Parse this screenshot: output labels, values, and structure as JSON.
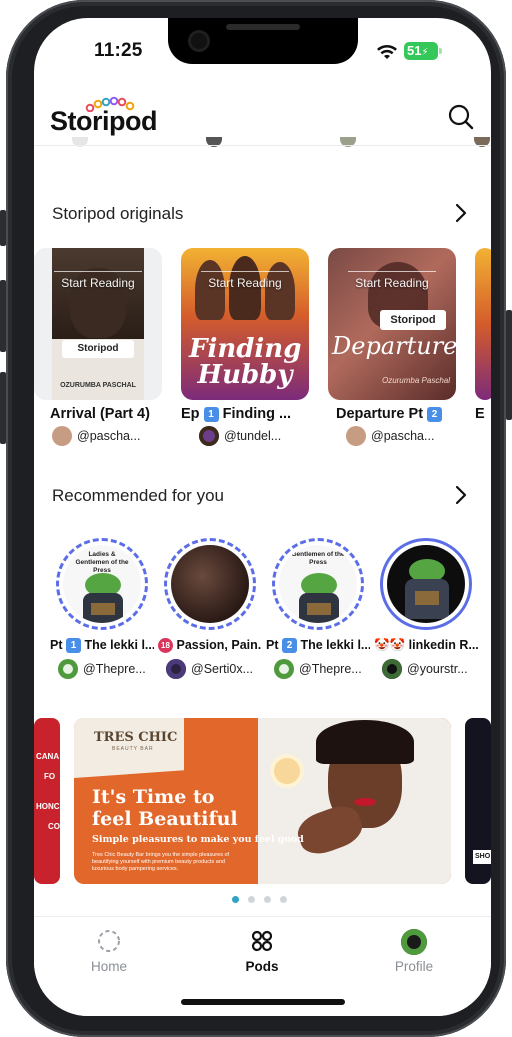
{
  "status_bar": {
    "time": "11:25",
    "battery": "51"
  },
  "header": {
    "logo_text": "Storipod",
    "search_icon": "search-icon"
  },
  "originals": {
    "title": "Storipod originals",
    "start_label": "Start Reading",
    "items": [
      {
        "title": "Arrival (Part 4)",
        "author": "@pascha...",
        "cover_text": "Storipod",
        "cover_sub": "OZURUMBA PASCHAL"
      },
      {
        "title_prefix": "Ep",
        "badge": "1",
        "title": "Finding ...",
        "author": "@tundel...",
        "cover_text": "Finding Hubby"
      },
      {
        "title": "Departure Pt",
        "badge": "2",
        "author": "@pascha...",
        "cover_text": "Departure",
        "cover_brand": "Storipod",
        "cover_sub": "Ozurumba Paschal"
      }
    ]
  },
  "recommended": {
    "title": "Recommended for you",
    "items": [
      {
        "prefix": "Pt",
        "badge": "1",
        "title": "The lekki l...",
        "author": "@Thepre...",
        "ring_text": "Ladies & Gentlemen of the Press"
      },
      {
        "badge": "18",
        "title": "Passion, Pain...",
        "author": "@Serti0x..."
      },
      {
        "prefix": "Pt",
        "badge": "2",
        "title": "The lekki l...",
        "author": "@Thepre...",
        "ring_text": "Gentlemen of the Press"
      },
      {
        "emoji": "🤡🤡",
        "title": "linkedin R...",
        "author": "@yourstr..."
      }
    ]
  },
  "banner": {
    "brand": "TRES CHIC",
    "brand_sub": "BEAUTY BAR",
    "headline_1": "It's Time to",
    "headline_2": "feel Beautiful",
    "tagline": "Simple pleasures to make you feel good",
    "body": "Tres Chic Beauty Bar brings you the simple pleasures of beautifying yourself with premium beauty products and luxurious body pampering services.",
    "left_peek": [
      "CANA",
      "FO",
      "HONC",
      "CO"
    ],
    "right_peek": "SHO"
  },
  "carousel": {
    "count": 4,
    "active_index": 0
  },
  "tabs": [
    {
      "label": "Home",
      "icon": "home-icon"
    },
    {
      "label": "Pods",
      "icon": "pods-grid-icon"
    },
    {
      "label": "Profile",
      "icon": "avatar"
    }
  ],
  "colors": {
    "accent": "#5b6ee8",
    "active_dot": "#2ea3c4",
    "banner_orange": "#e2672a",
    "battery": "#34c759"
  }
}
